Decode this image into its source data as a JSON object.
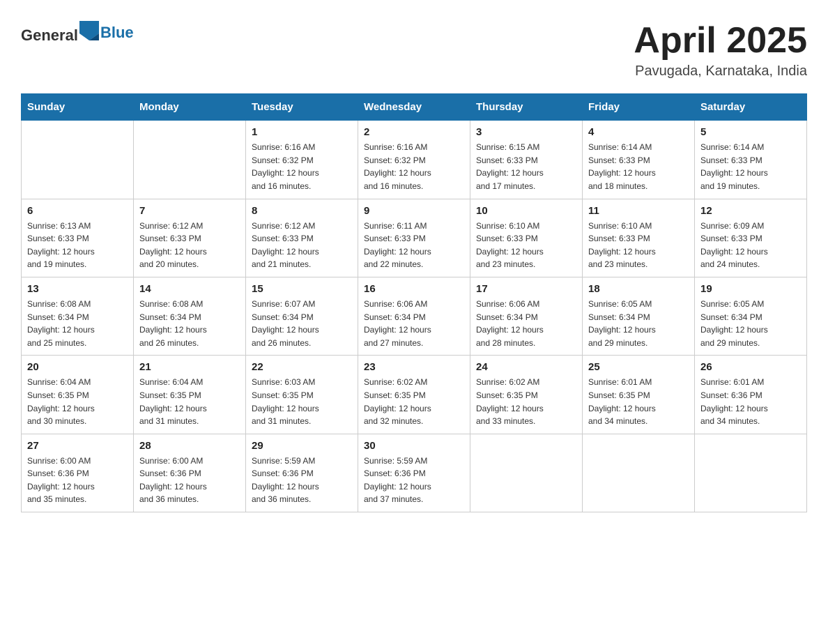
{
  "header": {
    "logo_text_general": "General",
    "logo_text_blue": "Blue",
    "title": "April 2025",
    "subtitle": "Pavugada, Karnataka, India"
  },
  "weekdays": [
    "Sunday",
    "Monday",
    "Tuesday",
    "Wednesday",
    "Thursday",
    "Friday",
    "Saturday"
  ],
  "weeks": [
    [
      {
        "day": "",
        "info": ""
      },
      {
        "day": "",
        "info": ""
      },
      {
        "day": "1",
        "info": "Sunrise: 6:16 AM\nSunset: 6:32 PM\nDaylight: 12 hours\nand 16 minutes."
      },
      {
        "day": "2",
        "info": "Sunrise: 6:16 AM\nSunset: 6:32 PM\nDaylight: 12 hours\nand 16 minutes."
      },
      {
        "day": "3",
        "info": "Sunrise: 6:15 AM\nSunset: 6:33 PM\nDaylight: 12 hours\nand 17 minutes."
      },
      {
        "day": "4",
        "info": "Sunrise: 6:14 AM\nSunset: 6:33 PM\nDaylight: 12 hours\nand 18 minutes."
      },
      {
        "day": "5",
        "info": "Sunrise: 6:14 AM\nSunset: 6:33 PM\nDaylight: 12 hours\nand 19 minutes."
      }
    ],
    [
      {
        "day": "6",
        "info": "Sunrise: 6:13 AM\nSunset: 6:33 PM\nDaylight: 12 hours\nand 19 minutes."
      },
      {
        "day": "7",
        "info": "Sunrise: 6:12 AM\nSunset: 6:33 PM\nDaylight: 12 hours\nand 20 minutes."
      },
      {
        "day": "8",
        "info": "Sunrise: 6:12 AM\nSunset: 6:33 PM\nDaylight: 12 hours\nand 21 minutes."
      },
      {
        "day": "9",
        "info": "Sunrise: 6:11 AM\nSunset: 6:33 PM\nDaylight: 12 hours\nand 22 minutes."
      },
      {
        "day": "10",
        "info": "Sunrise: 6:10 AM\nSunset: 6:33 PM\nDaylight: 12 hours\nand 23 minutes."
      },
      {
        "day": "11",
        "info": "Sunrise: 6:10 AM\nSunset: 6:33 PM\nDaylight: 12 hours\nand 23 minutes."
      },
      {
        "day": "12",
        "info": "Sunrise: 6:09 AM\nSunset: 6:33 PM\nDaylight: 12 hours\nand 24 minutes."
      }
    ],
    [
      {
        "day": "13",
        "info": "Sunrise: 6:08 AM\nSunset: 6:34 PM\nDaylight: 12 hours\nand 25 minutes."
      },
      {
        "day": "14",
        "info": "Sunrise: 6:08 AM\nSunset: 6:34 PM\nDaylight: 12 hours\nand 26 minutes."
      },
      {
        "day": "15",
        "info": "Sunrise: 6:07 AM\nSunset: 6:34 PM\nDaylight: 12 hours\nand 26 minutes."
      },
      {
        "day": "16",
        "info": "Sunrise: 6:06 AM\nSunset: 6:34 PM\nDaylight: 12 hours\nand 27 minutes."
      },
      {
        "day": "17",
        "info": "Sunrise: 6:06 AM\nSunset: 6:34 PM\nDaylight: 12 hours\nand 28 minutes."
      },
      {
        "day": "18",
        "info": "Sunrise: 6:05 AM\nSunset: 6:34 PM\nDaylight: 12 hours\nand 29 minutes."
      },
      {
        "day": "19",
        "info": "Sunrise: 6:05 AM\nSunset: 6:34 PM\nDaylight: 12 hours\nand 29 minutes."
      }
    ],
    [
      {
        "day": "20",
        "info": "Sunrise: 6:04 AM\nSunset: 6:35 PM\nDaylight: 12 hours\nand 30 minutes."
      },
      {
        "day": "21",
        "info": "Sunrise: 6:04 AM\nSunset: 6:35 PM\nDaylight: 12 hours\nand 31 minutes."
      },
      {
        "day": "22",
        "info": "Sunrise: 6:03 AM\nSunset: 6:35 PM\nDaylight: 12 hours\nand 31 minutes."
      },
      {
        "day": "23",
        "info": "Sunrise: 6:02 AM\nSunset: 6:35 PM\nDaylight: 12 hours\nand 32 minutes."
      },
      {
        "day": "24",
        "info": "Sunrise: 6:02 AM\nSunset: 6:35 PM\nDaylight: 12 hours\nand 33 minutes."
      },
      {
        "day": "25",
        "info": "Sunrise: 6:01 AM\nSunset: 6:35 PM\nDaylight: 12 hours\nand 34 minutes."
      },
      {
        "day": "26",
        "info": "Sunrise: 6:01 AM\nSunset: 6:36 PM\nDaylight: 12 hours\nand 34 minutes."
      }
    ],
    [
      {
        "day": "27",
        "info": "Sunrise: 6:00 AM\nSunset: 6:36 PM\nDaylight: 12 hours\nand 35 minutes."
      },
      {
        "day": "28",
        "info": "Sunrise: 6:00 AM\nSunset: 6:36 PM\nDaylight: 12 hours\nand 36 minutes."
      },
      {
        "day": "29",
        "info": "Sunrise: 5:59 AM\nSunset: 6:36 PM\nDaylight: 12 hours\nand 36 minutes."
      },
      {
        "day": "30",
        "info": "Sunrise: 5:59 AM\nSunset: 6:36 PM\nDaylight: 12 hours\nand 37 minutes."
      },
      {
        "day": "",
        "info": ""
      },
      {
        "day": "",
        "info": ""
      },
      {
        "day": "",
        "info": ""
      }
    ]
  ]
}
